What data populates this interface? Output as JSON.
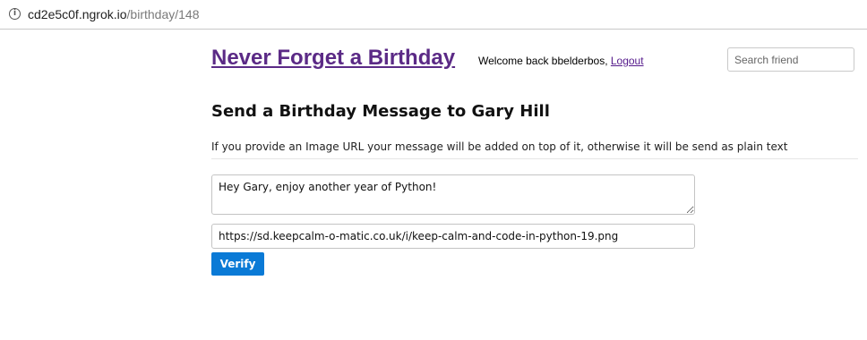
{
  "browser": {
    "url_host": "cd2e5c0f.ngrok.io",
    "url_path": "/birthday/148",
    "info_icon": "info-icon"
  },
  "header": {
    "site_title": "Never Forget a Birthday",
    "welcome_text": "Welcome back bbelderbos, ",
    "logout_label": "Logout",
    "search_placeholder": "Search friend"
  },
  "main": {
    "heading": "Send a Birthday Message to Gary Hill",
    "note": "If you provide an Image URL your message will be added on top of it, otherwise it will be send as plain text",
    "message_value": "Hey Gary, enjoy another year of Python!",
    "image_url_value": "https://sd.keepcalm-o-matic.co.uk/i/keep-calm-and-code-in-python-19.png",
    "verify_label": "Verify"
  },
  "colors": {
    "title_link": "#5b2a86",
    "logout_link": "#551a8b",
    "button_bg": "#0a7ad6",
    "button_text": "#ffffff"
  }
}
